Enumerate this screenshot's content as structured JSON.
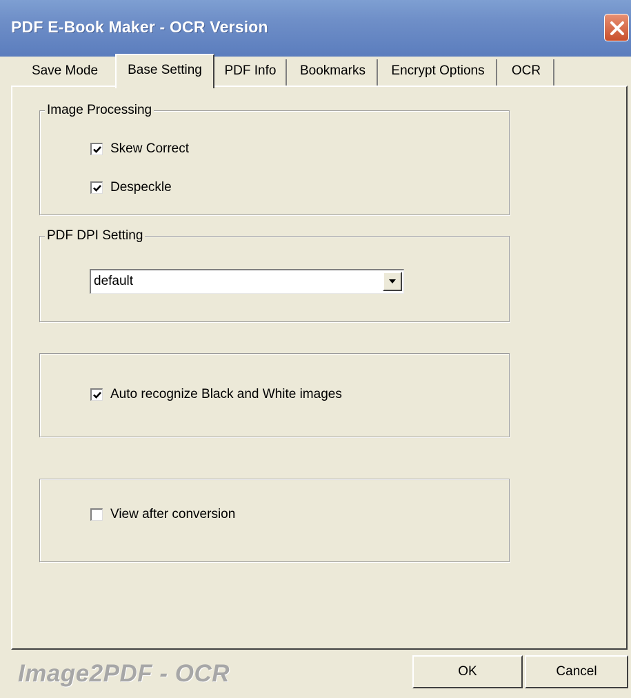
{
  "window": {
    "title": "PDF E-Book Maker - OCR Version"
  },
  "tabs": [
    {
      "label": "Save Mode",
      "active": false
    },
    {
      "label": "Base Setting",
      "active": true
    },
    {
      "label": "PDF Info",
      "active": false
    },
    {
      "label": "Bookmarks",
      "active": false
    },
    {
      "label": "Encrypt Options",
      "active": false
    },
    {
      "label": "OCR",
      "active": false
    }
  ],
  "image_processing": {
    "legend": "Image Processing",
    "skew_correct": {
      "label": "Skew Correct",
      "checked": true
    },
    "despeckle": {
      "label": "Despeckle",
      "checked": true
    }
  },
  "dpi_setting": {
    "legend": "PDF DPI Setting",
    "selected": "default"
  },
  "auto_bw": {
    "label": "Auto recognize Black and White images",
    "checked": true
  },
  "view_after": {
    "label": "View after conversion",
    "checked": false
  },
  "footer": {
    "brand": "Image2PDF - OCR",
    "ok_label": "OK",
    "cancel_label": "Cancel"
  },
  "colors": {
    "titlebar": "#6f8fc8",
    "dialog_bg": "#ece9d8",
    "close_button": "#d4603d",
    "brand_text": "#a7a7a7"
  }
}
